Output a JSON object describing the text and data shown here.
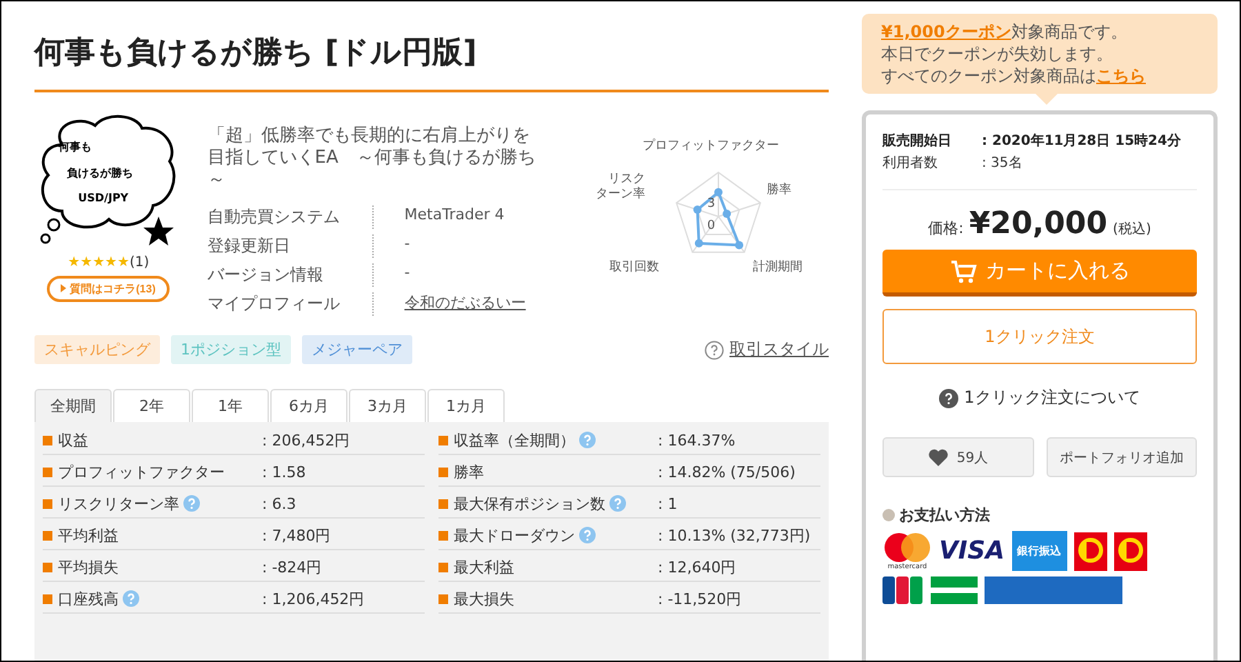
{
  "title": "何事も負けるが勝ち [ドル円版]",
  "thumbnail": {
    "lines": [
      "何事も",
      "負けるが勝ち",
      "USD/JPY"
    ]
  },
  "rating": {
    "stars": 5,
    "count": "(1)"
  },
  "question_button": "質問はコチラ(13)",
  "description": "「超」低勝率でも長期的に右肩上がりを目指していくEA　～何事も負けるが勝ち～",
  "info": [
    {
      "label": "自動売買システム",
      "value": "MetaTrader 4",
      "kind": "text"
    },
    {
      "label": "登録更新日",
      "value": "-",
      "kind": "text"
    },
    {
      "label": "バージョン情報",
      "value": "-",
      "kind": "text"
    },
    {
      "label": "マイプロフィール",
      "value": "令和のだぶるいー",
      "kind": "link"
    }
  ],
  "radar": {
    "axes": [
      {
        "lines": [
          "プロフィットファクター"
        ]
      },
      {
        "lines": [
          "勝率"
        ]
      },
      {
        "lines": [
          "計測期間"
        ]
      },
      {
        "lines": [
          "取引回数"
        ]
      },
      {
        "lines": [
          "リスク",
          "ターン率"
        ]
      }
    ],
    "ticks": [
      "3",
      "0"
    ]
  },
  "style_link": "取引スタイル",
  "tags": [
    {
      "label": "スキャルピング",
      "color": "#f39a3c"
    },
    {
      "label": "1ポジション型",
      "color": "#5cc3c0"
    },
    {
      "label": "メジャーペア",
      "color": "#4f8fd6"
    }
  ],
  "tabs": [
    {
      "label": "全期間",
      "selected": true
    },
    {
      "label": "2年",
      "selected": false
    },
    {
      "label": "1年",
      "selected": false
    },
    {
      "label": "6カ月",
      "selected": false
    },
    {
      "label": "3カ月",
      "selected": false
    },
    {
      "label": "1カ月",
      "selected": false
    }
  ],
  "stats": {
    "left": [
      {
        "label": "収益",
        "value": ": 206,452円",
        "help": false
      },
      {
        "label": "プロフィットファクター",
        "value": ": 1.58",
        "help": false
      },
      {
        "label": "リスクリターン率",
        "value": ": 6.3",
        "help": true
      },
      {
        "label": "平均利益",
        "value": ": 7,480円",
        "help": false
      },
      {
        "label": "平均損失",
        "value": ": -824円",
        "help": false
      },
      {
        "label": "口座残高",
        "value": ": 1,206,452円",
        "help": true
      }
    ],
    "right": [
      {
        "label": "収益率（全期間）",
        "value": ": 164.37%",
        "help": true
      },
      {
        "label": "勝率",
        "value": ": 14.82% (75/506)",
        "help": false
      },
      {
        "label": "最大保有ポジション数",
        "value": ": 1",
        "help": true
      },
      {
        "label": "最大ドローダウン",
        "value": ": 10.13% (32,773円)",
        "help": true
      },
      {
        "label": "最大利益",
        "value": ": 12,640円",
        "help": false
      },
      {
        "label": "最大損失",
        "value": ": -11,520円",
        "help": false
      }
    ]
  },
  "coupon": {
    "amount_link": "¥1,000クーポン",
    "text": "対象商品です。",
    "line2": "本日でクーポンが失効します。",
    "line3": "すべてのクーポン対象商品は",
    "link": "こちら"
  },
  "sales": [
    {
      "label": "販売開始日",
      "value": ":  2020年11月28日 15時24分",
      "bold": true
    },
    {
      "label": "利用者数",
      "value": ": 35名",
      "bold": false
    }
  ],
  "price": {
    "label": "価格:",
    "amount": "¥20,000",
    "tax": "(税込)"
  },
  "cart_button": "カートに入れる",
  "one_click_button": "1クリック注文",
  "one_click_help": "1クリック注文について",
  "like_button": "59人",
  "portfolio_button": "ポートフォリオ追加",
  "payment": {
    "title": "お支払い方法",
    "methods": [
      {
        "kind": "mastercard",
        "label": "mastercard"
      },
      {
        "kind": "visa",
        "label": "VISA"
      },
      {
        "kind": "bank",
        "label": "銀行振込"
      },
      {
        "kind": "d-logo"
      },
      {
        "kind": "d-logo"
      },
      {
        "kind": "jcb"
      },
      {
        "kind": "green"
      },
      {
        "kind": "blue"
      }
    ]
  }
}
